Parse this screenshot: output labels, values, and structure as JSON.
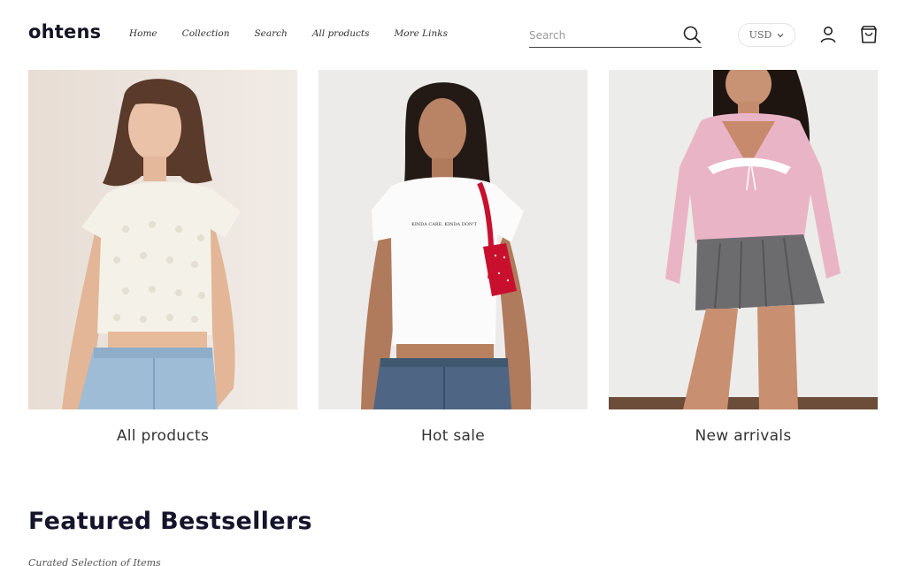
{
  "header": {
    "logo": "ohtens",
    "nav": [
      "Home",
      "Collection",
      "Search",
      "All products",
      "More Links"
    ],
    "search_placeholder": "Search",
    "currency": "USD"
  },
  "collections": [
    {
      "label": "All products",
      "image": "model in cream knit top and light blue jeans"
    },
    {
      "label": "Hot sale",
      "image": "model in white graphic tee with red shoulder bag"
    },
    {
      "label": "New arrivals",
      "image": "model in pink cardigan and grey pleated skirt"
    }
  ],
  "featured": {
    "title": "Featured Bestsellers",
    "subtitle": "Curated Selection of Items"
  },
  "colors": {
    "text": "#1a1a2e",
    "accent_red": "#c8102e",
    "pink": "#e8b8c8"
  },
  "product_print": "KINDA CARE, KINDA DON'T"
}
